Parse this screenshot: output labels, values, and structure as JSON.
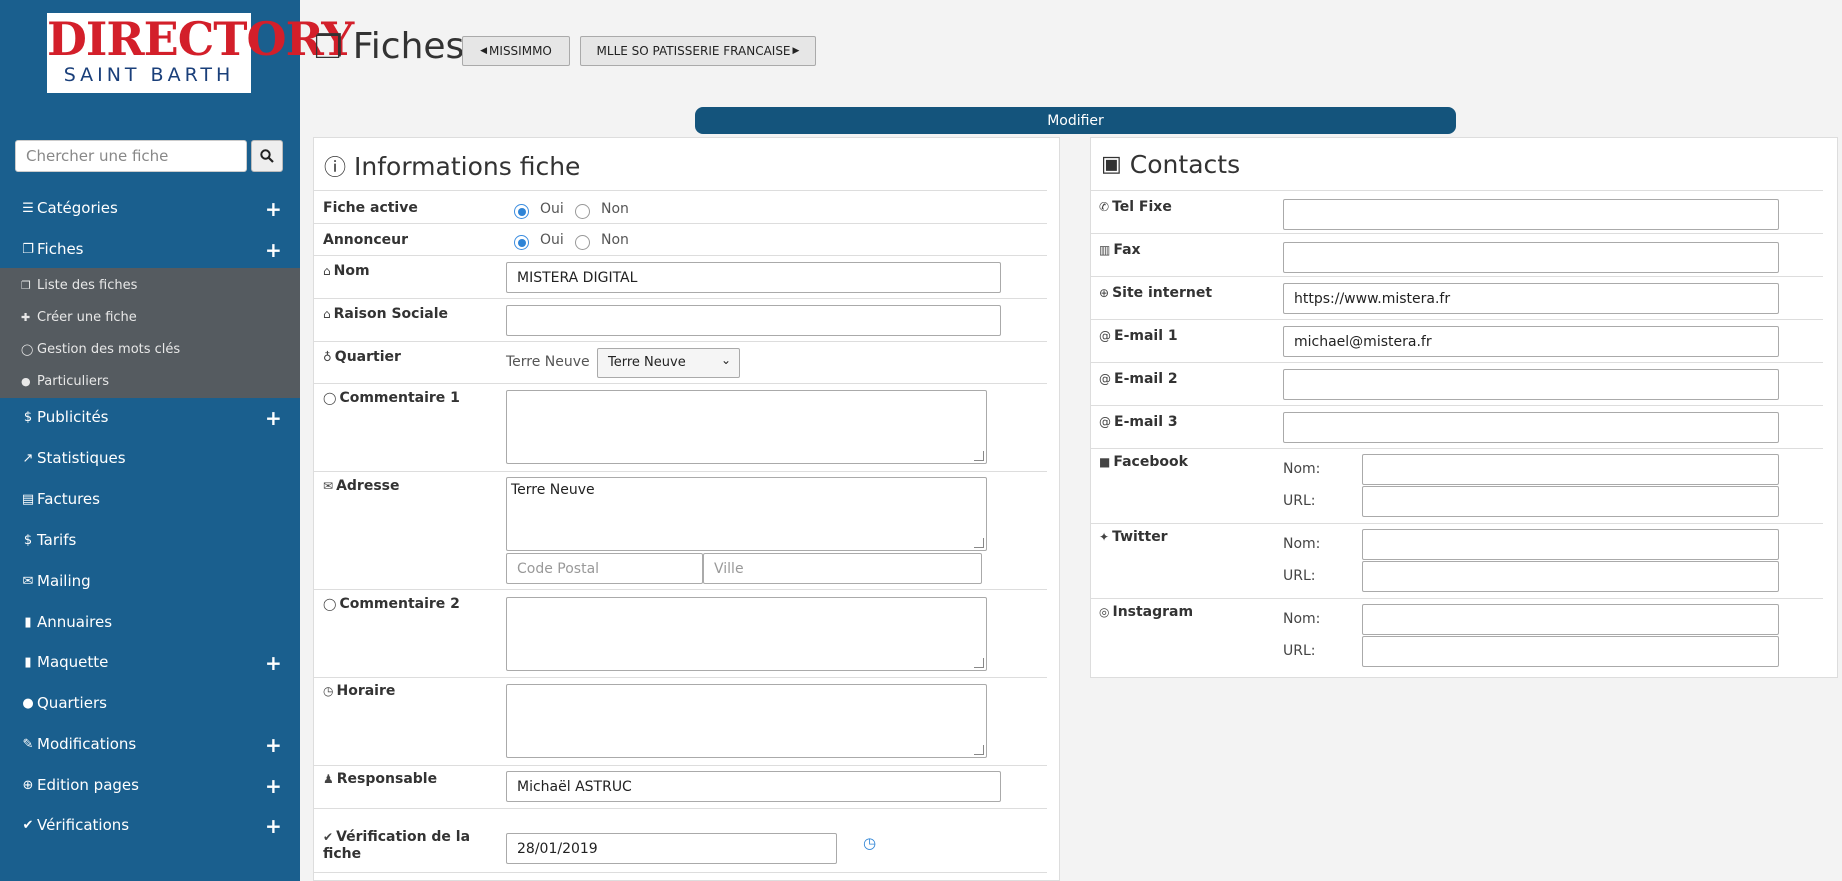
{
  "logo": {
    "line1": "DIRECTORY",
    "line2": "SAINT BARTH"
  },
  "search": {
    "placeholder": "Chercher une fiche",
    "icon": "search-icon"
  },
  "sidebar": {
    "items": [
      {
        "label": "Catégories",
        "icon": "bars-icon",
        "expand": "+"
      },
      {
        "label": "Fiches",
        "icon": "files-icon",
        "expand": "+"
      },
      {
        "label": "Publicités",
        "icon": "dollar-icon",
        "expand": "+"
      },
      {
        "label": "Statistiques",
        "icon": "chart-icon"
      },
      {
        "label": "Factures",
        "icon": "file-icon"
      },
      {
        "label": "Tarifs",
        "icon": "dollar-icon"
      },
      {
        "label": "Mailing",
        "icon": "envelope-icon"
      },
      {
        "label": "Annuaires",
        "icon": "book-icon"
      },
      {
        "label": "Maquette",
        "icon": "book-icon",
        "expand": "+"
      },
      {
        "label": "Quartiers",
        "icon": "map-marker-icon"
      },
      {
        "label": "Modifications",
        "icon": "pencil-icon",
        "expand": "+"
      },
      {
        "label": "Edition pages",
        "icon": "globe-icon",
        "expand": "+"
      },
      {
        "label": "Vérifications",
        "icon": "check-icon",
        "expand": "+"
      }
    ],
    "fiches_submenu": [
      {
        "label": "Liste des fiches",
        "icon": "files-icon"
      },
      {
        "label": "Créer une fiche",
        "icon": "plus-icon"
      },
      {
        "label": "Gestion des mots clés",
        "icon": "comment-icon"
      },
      {
        "label": "Particuliers",
        "icon": "user-icon"
      }
    ]
  },
  "header": {
    "title": "Fiches",
    "prev_label": "MISSIMMO",
    "next_label": "MLLE SO PATISSERIE FRANCAISE",
    "modifier_label": "Modifier"
  },
  "info": {
    "title": "Informations fiche",
    "fiche_active": {
      "label": "Fiche active",
      "oui": "Oui",
      "non": "Non",
      "selected": "Oui"
    },
    "annonceur": {
      "label": "Annonceur",
      "oui": "Oui",
      "non": "Non",
      "selected": "Oui"
    },
    "nom": {
      "label": "Nom",
      "value": "MISTERA DIGITAL"
    },
    "raison_sociale": {
      "label": "Raison Sociale",
      "value": ""
    },
    "quartier": {
      "label": "Quartier",
      "current": "Terre Neuve",
      "selected": "Terre Neuve"
    },
    "commentaire1": {
      "label": "Commentaire 1",
      "value": ""
    },
    "adresse": {
      "label": "Adresse",
      "value": "Terre Neuve",
      "code_postal_placeholder": "Code Postal",
      "ville_placeholder": "Ville"
    },
    "commentaire2": {
      "label": "Commentaire 2",
      "value": ""
    },
    "horaire": {
      "label": "Horaire",
      "value": ""
    },
    "responsable": {
      "label": "Responsable",
      "value": "Michaël ASTRUC"
    },
    "verification": {
      "label_1": "Vérification de la",
      "label_2": "fiche",
      "value": "28/01/2019"
    }
  },
  "contacts": {
    "title": "Contacts",
    "tel_fixe": {
      "label": "Tel Fixe",
      "value": ""
    },
    "fax": {
      "label": "Fax",
      "value": ""
    },
    "site": {
      "label": "Site internet",
      "value": "https://www.mistera.fr"
    },
    "email1": {
      "label": "E-mail 1",
      "value": "michael@mistera.fr"
    },
    "email2": {
      "label": "E-mail 2",
      "value": ""
    },
    "email3": {
      "label": "E-mail 3",
      "value": ""
    },
    "facebook": {
      "label": "Facebook",
      "nom_label": "Nom:",
      "url_label": "URL:"
    },
    "twitter": {
      "label": "Twitter",
      "nom_label": "Nom:",
      "url_label": "URL:"
    },
    "instagram": {
      "label": "Instagram",
      "nom_label": "Nom:",
      "url_label": "URL:"
    }
  }
}
